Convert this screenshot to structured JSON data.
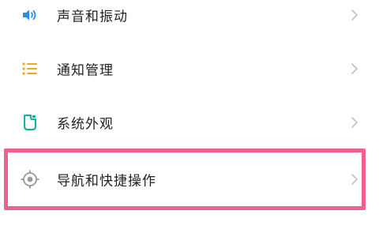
{
  "settings": {
    "items": [
      {
        "label": "声音和振动",
        "icon": "speaker-icon"
      },
      {
        "label": "通知管理",
        "icon": "list-icon"
      },
      {
        "label": "系统外观",
        "icon": "appearance-icon"
      },
      {
        "label": "导航和快捷操作",
        "icon": "navigation-target-icon"
      }
    ],
    "highlighted_index": 3
  },
  "colors": {
    "icon_blue": "#2a8ee3",
    "icon_orange": "#f0a71b",
    "icon_teal": "#16b39d",
    "icon_gray": "#9a9a9a",
    "chevron": "#c0c0c0",
    "highlight_border": "#ef5f92"
  }
}
